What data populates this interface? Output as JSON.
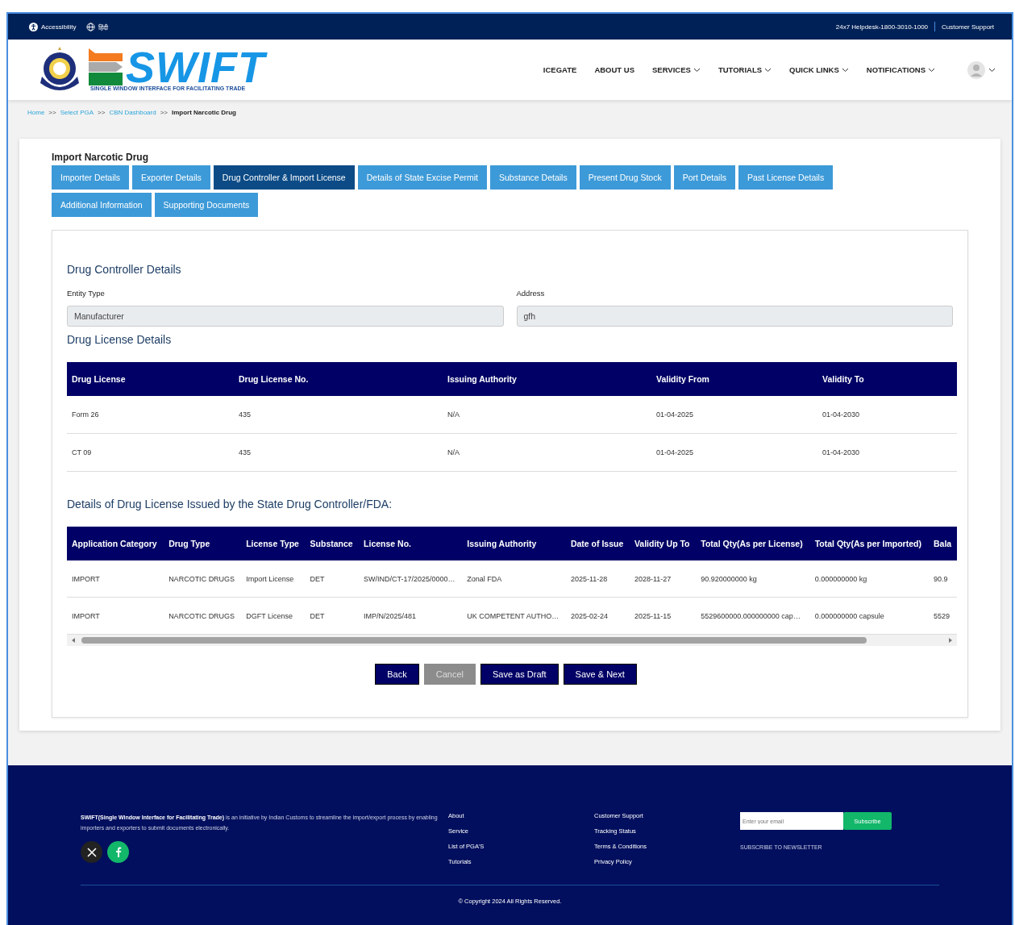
{
  "top_bar": {
    "accessibility": "Accessibility",
    "language": "हिंदी",
    "helpdesk": "24x7 Helpdesk-1800-3010-1000",
    "support": "Customer Support"
  },
  "header": {
    "logo_text": "SWIFT",
    "logo_tagline": "SINGLE WINDOW INTERFACE FOR FACILITATING TRADE",
    "nav": [
      {
        "label": "ICEGATE",
        "dropdown": false
      },
      {
        "label": "ABOUT US",
        "dropdown": false
      },
      {
        "label": "SERVICES",
        "dropdown": true
      },
      {
        "label": "TUTORIALS",
        "dropdown": true
      },
      {
        "label": "QUICK LINKS",
        "dropdown": true
      },
      {
        "label": "NOTIFICATIONS",
        "dropdown": true
      }
    ]
  },
  "breadcrumb": {
    "separator": ">>",
    "items": [
      {
        "label": "Home",
        "current": false
      },
      {
        "label": "Select PGA",
        "current": false
      },
      {
        "label": "CBN Dashboard",
        "current": false
      },
      {
        "label": "Import Narcotic Drug",
        "current": true
      }
    ]
  },
  "form_title": "Import Narcotic Drug",
  "tabs": [
    {
      "label": "Importer Details",
      "selected": false
    },
    {
      "label": "Exporter Details",
      "selected": false
    },
    {
      "label": "Drug Controller & Import License",
      "selected": true
    },
    {
      "label": "Details of State Excise Permit",
      "selected": false
    },
    {
      "label": "Substance Details",
      "selected": false
    },
    {
      "label": "Present Drug Stock",
      "selected": false
    },
    {
      "label": "Port Details",
      "selected": false
    },
    {
      "label": "Past License Details",
      "selected": false
    },
    {
      "label": "Additional Information",
      "selected": false
    },
    {
      "label": "Supporting Documents",
      "selected": false
    }
  ],
  "drug_controller": {
    "title": "Drug Controller Details",
    "fields": [
      {
        "label": "Entity Type",
        "value": "Manufacturer"
      },
      {
        "label": "Address",
        "value": "gfh"
      }
    ]
  },
  "drug_license": {
    "title": "Drug License Details",
    "columns": [
      "Drug License",
      "Drug License No.",
      "Issuing Authority",
      "Validity From",
      "Validity To"
    ],
    "rows": [
      [
        "Form 26",
        "435",
        "N/A",
        "01-04-2025",
        "01-04-2030"
      ],
      [
        "CT 09",
        "435",
        "N/A",
        "01-04-2025",
        "01-04-2030"
      ]
    ]
  },
  "state_license": {
    "title": "Details of Drug License Issued by the State Drug Controller/FDA:",
    "columns": [
      "Application Category",
      "Drug Type",
      "License Type",
      "Substance",
      "License No.",
      "Issuing Authority",
      "Date of Issue",
      "Validity Up To",
      "Total Qty(As per License)",
      "Total Qty(As per Imported)",
      "Bala"
    ],
    "rows": [
      [
        "IMPORT",
        "NARCOTIC DRUGS",
        "Import License",
        "DET",
        "SW/IND/CT-17/2025/0000…",
        "Zonal FDA",
        "2025-11-28",
        "2028-11-27",
        "90.920000000 kg",
        "0.000000000 kg",
        "90.9"
      ],
      [
        "IMPORT",
        "NARCOTIC DRUGS",
        "DGFT License",
        "DET",
        "IMP/N/2025/481",
        "UK COMPETENT AUTHO…",
        "2025-02-24",
        "2025-11-15",
        "5529600000.000000000 cap…",
        "0.000000000 capsule",
        "5529"
      ]
    ]
  },
  "buttons": [
    {
      "label": "Back",
      "disabled": false
    },
    {
      "label": "Cancel",
      "disabled": true
    },
    {
      "label": "Save as Draft",
      "disabled": false
    },
    {
      "label": "Save & Next",
      "disabled": false
    }
  ],
  "footer": {
    "about_bold": "SWIFT(Single Window Interface for Facilitating Trade)",
    "about_text": " is an initiative by Indian Customs to streamline the import/export process by enabling importers and exporters to submit documents electronically.",
    "links_1": [
      "About",
      "Service",
      "List of PGA'S",
      "Tutorials"
    ],
    "links_2": [
      "Customer Support",
      "Tracking Status",
      "Terms & Conditions",
      "Privacy Policy"
    ],
    "email_placeholder": "Enter your email",
    "subscribe": "Subscribe",
    "newsletter": "SUBSCRIBE TO NEWSLETTER",
    "copyright": "© Copyright 2024 All Rights Reserved."
  }
}
